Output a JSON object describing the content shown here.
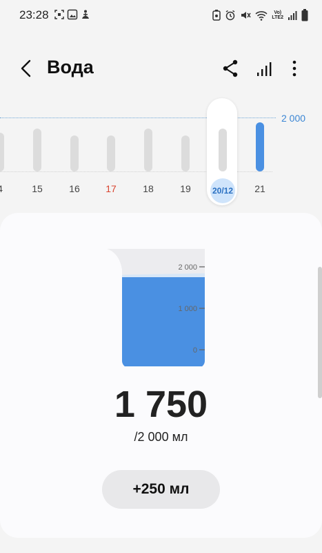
{
  "status": {
    "time": "23:28",
    "network": "LTE2",
    "volte": "Vo)"
  },
  "app": {
    "title": "Вода",
    "icons": [
      "back-arrow-icon",
      "share-icon",
      "stats-icon",
      "more-vert-icon"
    ]
  },
  "history": {
    "goal_label": "2 000",
    "days": [
      {
        "label": "4",
        "amount": 0.4,
        "holiday": false,
        "selected": false
      },
      {
        "label": "15",
        "amount": 0.44,
        "holiday": false,
        "selected": false
      },
      {
        "label": "16",
        "amount": 0.37,
        "holiday": false,
        "selected": false
      },
      {
        "label": "17",
        "amount": 0.37,
        "holiday": true,
        "selected": false
      },
      {
        "label": "18",
        "amount": 0.44,
        "holiday": false,
        "selected": false
      },
      {
        "label": "19",
        "amount": 0.37,
        "holiday": false,
        "selected": false
      },
      {
        "label": "20/12",
        "amount": 0.44,
        "holiday": false,
        "selected": true
      },
      {
        "label": "21",
        "amount": 0.51,
        "holiday": false,
        "selected": false,
        "filled": true
      }
    ]
  },
  "intake": {
    "scale": [
      "2 000",
      "1 000",
      "0"
    ],
    "level": 0.875,
    "amount": "1 750",
    "goal_text": "/2 000 мл",
    "add_label": "+250 мл"
  },
  "colors": {
    "accent": "#4a90e2",
    "holiday": "#d9442f"
  }
}
